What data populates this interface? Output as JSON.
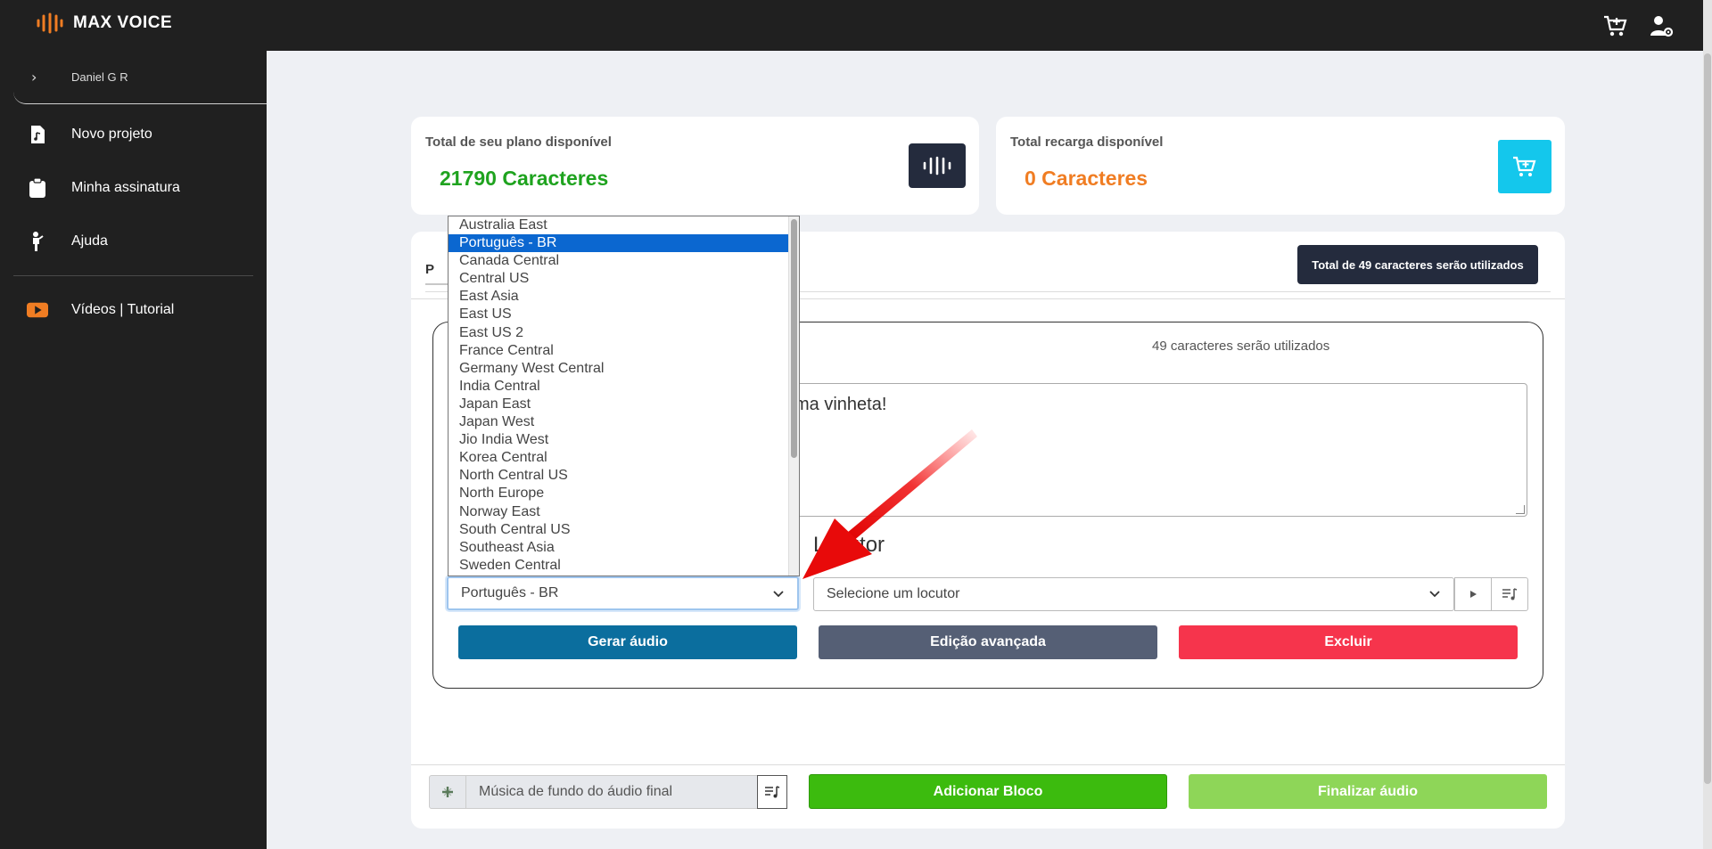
{
  "app": {
    "name": "MAX VOICE"
  },
  "user": {
    "name": "Daniel G R"
  },
  "sidebar": {
    "items": [
      {
        "label": "Novo projeto",
        "icon": "music-file-icon"
      },
      {
        "label": "Minha assinatura",
        "icon": "clipboard-icon"
      },
      {
        "label": "Ajuda",
        "icon": "help-person-icon"
      },
      {
        "label": "Vídeos | Tutorial",
        "icon": "youtube-play-icon"
      }
    ]
  },
  "plan": {
    "label": "Total de seu plano disponível",
    "value": "21790 Caracteres"
  },
  "recharge": {
    "label": "Total recarga disponível",
    "value": "0 Caracteres"
  },
  "panel": {
    "tab_label": "P",
    "chars_badge": "Total de 49 caracteres serão utilizados",
    "block_chars": "49 caracteres serão utilizados",
    "text_visible": "ma vinheta!",
    "locutor_label": "Locutor",
    "language_selected": "Português - BR",
    "voice_placeholder": "Selecione um locutor",
    "buttons": {
      "gerar": "Gerar áudio",
      "edicao": "Edição avançada",
      "excluir": "Excluir"
    }
  },
  "bottom": {
    "music_placeholder": "Música de fundo do áudio final",
    "add_block": "Adicionar Bloco",
    "finalize": "Finalizar áudio"
  },
  "dropdown": {
    "options": [
      "Australia East",
      "Português - BR",
      "Canada Central",
      "Central US",
      "East Asia",
      "East US",
      "East US 2",
      "France Central",
      "Germany West Central",
      "India Central",
      "Japan East",
      "Japan West",
      "Jio India West",
      "Korea Central",
      "North Central US",
      "North Europe",
      "Norway East",
      "South Central US",
      "Southeast Asia",
      "Sweden Central"
    ],
    "selected_index": 1
  },
  "colors": {
    "plan_green": "#1fa31f",
    "recharge_orange": "#f07d23",
    "gerar_blue": "#0b6e9e",
    "excluir_red": "#f6344c",
    "add_green": "#3cbb0e",
    "final_green": "#8ed658",
    "logo_orange": "#f07d23"
  }
}
